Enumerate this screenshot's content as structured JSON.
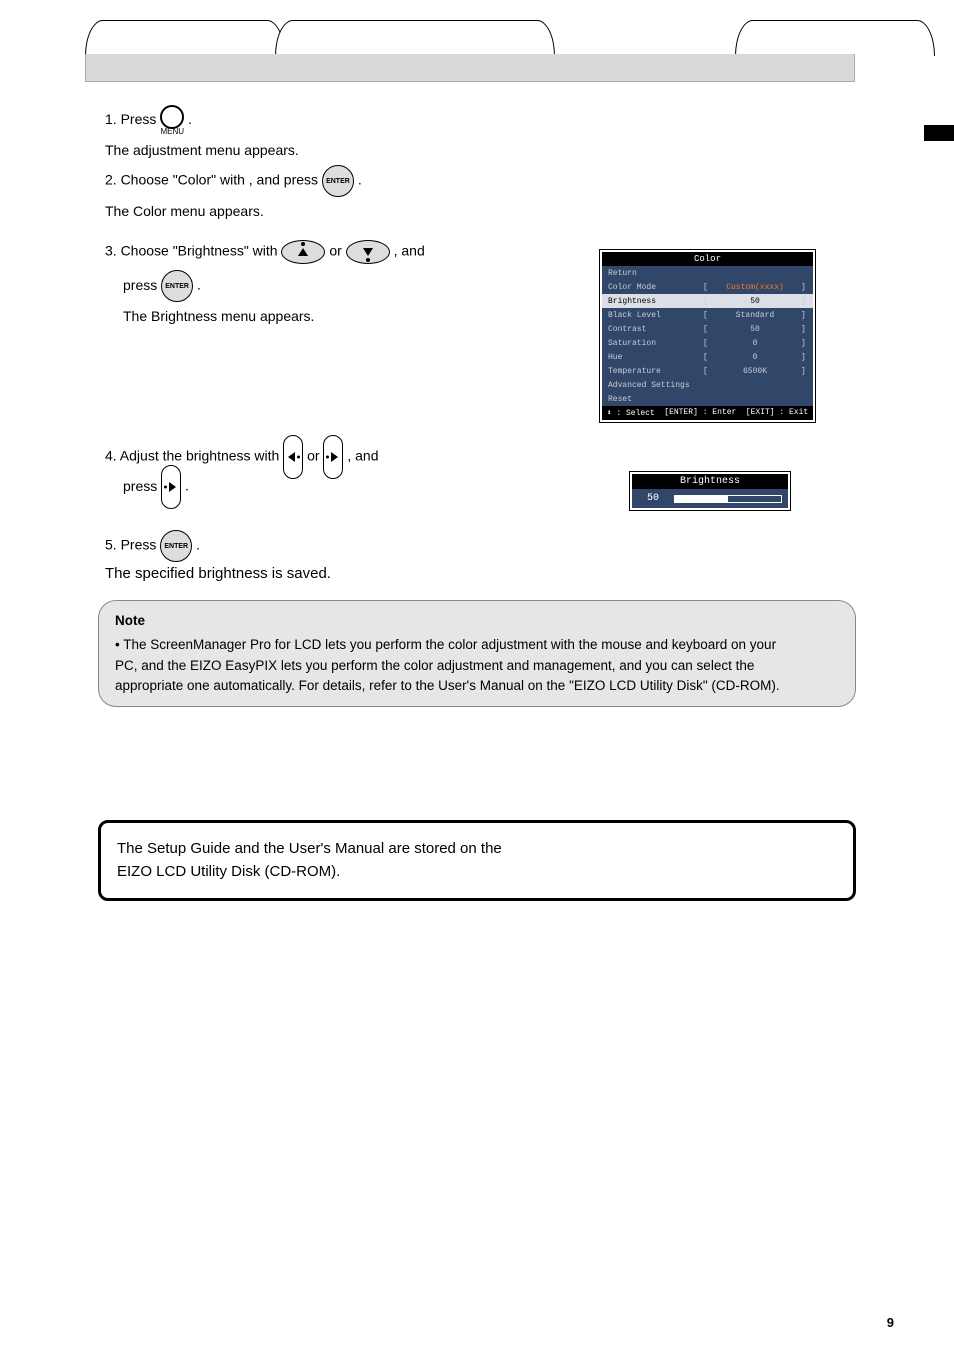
{
  "tabs": {
    "left": "",
    "mid": "",
    "active": "",
    "right": ""
  },
  "buttons": {
    "menu": "MENU",
    "enter": "ENTER"
  },
  "steps": {
    "s1a": "1. Press ",
    "s1b": ".",
    "s1c": "The adjustment menu appears.",
    "s2a": "2. Choose \"Color\" with ",
    "s2b": ", and press ",
    "s2c": ".",
    "s2d": "The Color menu appears.",
    "s3a": "3. Choose \"Brightness\" with ",
    "s3b": " or ",
    "s3c": ", and",
    "s3d": "press ",
    "s3e": ".",
    "s3f": "The Brightness menu appears.",
    "s4a": "4. Adjust the brightness with ",
    "s4b": " or ",
    "s4c": ", and",
    "s4d": "press ",
    "s4e": ".",
    "s5a": "5. Press ",
    "s5b": ".",
    "saved": "The specified brightness is saved."
  },
  "osd": {
    "title": "Color",
    "rows": [
      {
        "label": "Return",
        "val": ""
      },
      {
        "label": "Color Mode",
        "val": "Custom(xxxx)",
        "orange": true
      },
      {
        "label": "Brightness",
        "val": "50",
        "hl": true
      },
      {
        "label": "Black Level",
        "val": "Standard"
      },
      {
        "label": "Contrast",
        "val": "50"
      },
      {
        "label": "Saturation",
        "val": "0"
      },
      {
        "label": "Hue",
        "val": "0"
      },
      {
        "label": "Temperature",
        "val": "6500K"
      },
      {
        "label": "Advanced Settings",
        "val": ""
      },
      {
        "label": "Reset",
        "val": ""
      }
    ],
    "footer": {
      "a": "⬍ : Select",
      "b": "[ENTER] : Enter",
      "c": "[EXIT] : Exit"
    }
  },
  "bright": {
    "title": "Brightness",
    "value": "50"
  },
  "note": {
    "title": "Note",
    "line1": "• The ScreenManager Pro for LCD lets you perform the color adjustment with the mouse and keyboard on your",
    "line2": "  PC, and the EIZO EasyPIX lets you perform the color adjustment and management, and you can select the",
    "line3": "  appropriate one automatically. For details, refer to the User's Manual on the \"EIZO LCD Utility Disk\" (CD-ROM)."
  },
  "blackbox": {
    "line1": "The Setup Guide and the User's Manual are stored on the",
    "line2": "EIZO LCD Utility Disk (CD-ROM)."
  },
  "page_no": "9"
}
